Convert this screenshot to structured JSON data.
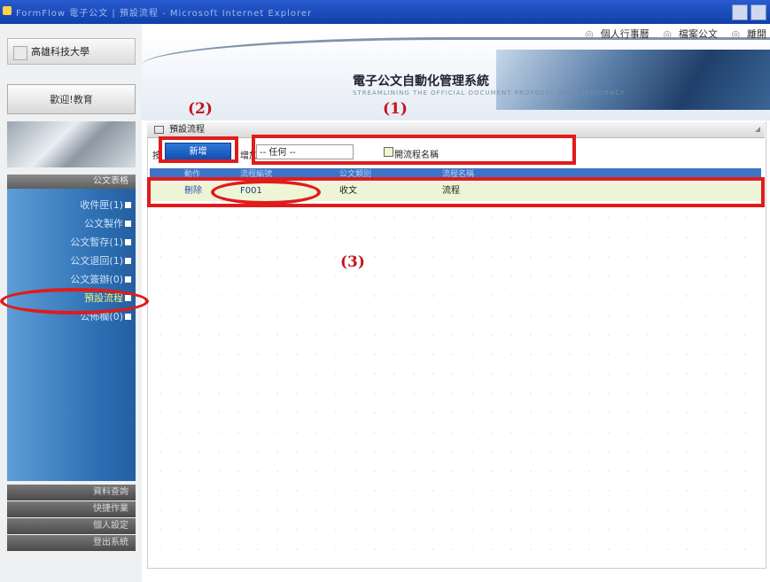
{
  "window": {
    "title": "FormFlow 電子公文 | 預設流程 - Microsoft Internet Explorer"
  },
  "top_links": [
    "個人行事曆",
    "檔案公文",
    "離開"
  ],
  "school_name": "高雄科技大學",
  "user_label": "歡迎!教育",
  "header": {
    "system_title": "電子公文自動化管理系統",
    "subtitle": "STREAMLINING THE OFFICIAL DOCUMENT PROPOSAL WITH EFFICIENCY"
  },
  "sidebar": {
    "header": "公文表格",
    "items": [
      {
        "label": "收件匣(1)",
        "active": false
      },
      {
        "label": "公文製作",
        "active": false
      },
      {
        "label": "公文暫存(1)",
        "active": false
      },
      {
        "label": "公文退回(1)",
        "active": false
      },
      {
        "label": "公文簽辦(0)",
        "active": false
      },
      {
        "label": "預設流程",
        "active": true
      },
      {
        "label": "公佈欄(0)",
        "active": false
      }
    ],
    "bottom": [
      "資料查詢",
      "快捷作業",
      "個人設定",
      "登出系統"
    ]
  },
  "panel": {
    "title": "預設流程"
  },
  "toolbar": {
    "press_text": "按",
    "add_label": "新增",
    "add_suffix": "增加",
    "select_value": "-- 任何 --",
    "checkbox_label": "開流程名稱"
  },
  "table": {
    "headers": [
      "動作",
      "流程編號",
      "公文類別",
      "流程名稱"
    ],
    "rows": [
      {
        "action": "刪除",
        "id": "F001",
        "category": "收文",
        "name": "流程"
      }
    ]
  },
  "annotations": [
    "(1)",
    "(2)",
    "(3)"
  ],
  "colors": {
    "accent": "#e11b1b",
    "menu_blue": "#2d6fb3",
    "header_blue": "#3e74c6"
  }
}
